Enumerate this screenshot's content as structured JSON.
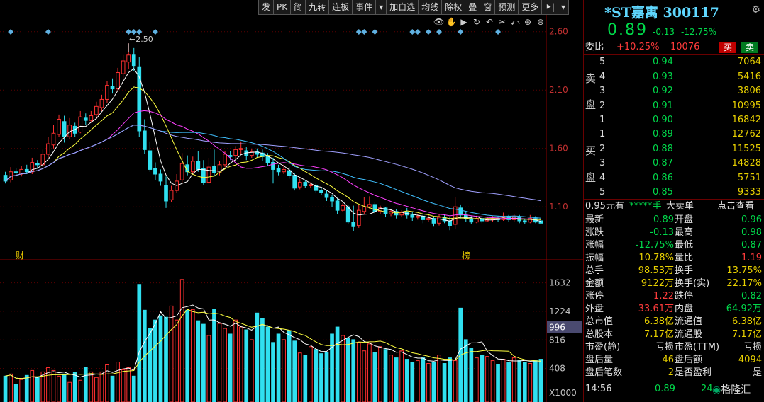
{
  "toolbar": [
    "发",
    "PK",
    "简",
    "九转",
    "连板",
    "事件",
    "▾",
    "加自选",
    "均线",
    "除权",
    "叠",
    "窗",
    "预测",
    "更多",
    "⯈|",
    "▾"
  ],
  "icons": [
    "eye-icon",
    "hand-icon",
    "play-icon",
    "refresh-icon",
    "undo-icon",
    "scissors-icon",
    "return-icon",
    "zoom-in-icon",
    "zoom-out-icon"
  ],
  "icon_glyphs": [
    "👁",
    "✋",
    "▶",
    "↻",
    "↶",
    "✂",
    "⤺",
    "⊕",
    "⊖"
  ],
  "chart_flags": {
    "left": "财",
    "right": "榜"
  },
  "chart_data": [
    {
      "type": "candlestick",
      "price_axis": [
        "2.60",
        "2.10",
        "1.60",
        "1.10"
      ],
      "ylim": [
        0.78,
        2.75
      ],
      "peak_label": "2.50",
      "peak_value": 2.5,
      "candles": [
        [
          1.37,
          1.32,
          1.4,
          1.3
        ],
        [
          1.33,
          1.4,
          1.44,
          1.31
        ],
        [
          1.4,
          1.39,
          1.43,
          1.36
        ],
        [
          1.38,
          1.42,
          1.45,
          1.36
        ],
        [
          1.42,
          1.4,
          1.46,
          1.38
        ],
        [
          1.4,
          1.48,
          1.52,
          1.38
        ],
        [
          1.47,
          1.46,
          1.5,
          1.43
        ],
        [
          1.46,
          1.55,
          1.59,
          1.44
        ],
        [
          1.55,
          1.64,
          1.7,
          1.52
        ],
        [
          1.63,
          1.73,
          1.8,
          1.6
        ],
        [
          1.72,
          1.85,
          1.89,
          1.7
        ],
        [
          1.83,
          1.7,
          1.88,
          1.65
        ],
        [
          1.7,
          1.8,
          1.86,
          1.68
        ],
        [
          1.79,
          1.73,
          1.82,
          1.7
        ],
        [
          1.74,
          1.87,
          1.92,
          1.73
        ],
        [
          1.86,
          1.84,
          1.9,
          1.8
        ],
        [
          1.84,
          1.88,
          1.92,
          1.82
        ],
        [
          1.89,
          1.96,
          2.0,
          1.86
        ],
        [
          1.95,
          2.02,
          2.06,
          1.92
        ],
        [
          2.02,
          2.14,
          2.18,
          1.99
        ],
        [
          2.13,
          2.11,
          2.2,
          2.07
        ],
        [
          2.11,
          2.25,
          2.29,
          2.09
        ],
        [
          2.24,
          2.35,
          2.4,
          2.2
        ],
        [
          2.34,
          2.4,
          2.5,
          2.28
        ],
        [
          2.4,
          2.31,
          2.46,
          2.26
        ],
        [
          2.3,
          1.75,
          2.38,
          1.7
        ],
        [
          1.75,
          1.59,
          1.85,
          1.55
        ],
        [
          1.58,
          1.42,
          1.66,
          1.4
        ],
        [
          1.43,
          1.38,
          1.48,
          1.33
        ],
        [
          1.38,
          1.32,
          1.42,
          1.28
        ],
        [
          1.28,
          1.15,
          1.36,
          1.09
        ],
        [
          1.16,
          1.24,
          1.28,
          1.14
        ],
        [
          1.24,
          1.32,
          1.38,
          1.22
        ],
        [
          1.33,
          1.47,
          1.56,
          1.3
        ],
        [
          1.46,
          1.4,
          1.54,
          1.37
        ],
        [
          1.4,
          1.49,
          1.53,
          1.38
        ],
        [
          1.49,
          1.42,
          1.58,
          1.4
        ],
        [
          1.43,
          1.31,
          1.5,
          1.29
        ],
        [
          1.31,
          1.44,
          1.52,
          1.3
        ],
        [
          1.45,
          1.39,
          1.59,
          1.36
        ],
        [
          1.39,
          1.46,
          1.49,
          1.37
        ],
        [
          1.46,
          1.55,
          1.58,
          1.44
        ],
        [
          1.54,
          1.53,
          1.58,
          1.5
        ],
        [
          1.54,
          1.59,
          1.62,
          1.51
        ],
        [
          1.59,
          1.6,
          1.66,
          1.55
        ],
        [
          1.58,
          1.54,
          1.61,
          1.5
        ],
        [
          1.54,
          1.57,
          1.6,
          1.52
        ],
        [
          1.57,
          1.55,
          1.6,
          1.52
        ],
        [
          1.56,
          1.53,
          1.59,
          1.49
        ],
        [
          1.53,
          1.48,
          1.56,
          1.45
        ],
        [
          1.48,
          1.42,
          1.52,
          1.3
        ],
        [
          1.43,
          1.4,
          1.46,
          1.37
        ],
        [
          1.4,
          1.42,
          1.46,
          1.38
        ],
        [
          1.41,
          1.37,
          1.44,
          1.34
        ],
        [
          1.37,
          1.26,
          1.39,
          1.24
        ],
        [
          1.27,
          1.31,
          1.34,
          1.25
        ],
        [
          1.31,
          1.28,
          1.33,
          1.26
        ],
        [
          1.28,
          1.29,
          1.31,
          1.26
        ],
        [
          1.28,
          1.24,
          1.3,
          1.22
        ],
        [
          1.24,
          1.22,
          1.27,
          1.2
        ],
        [
          1.21,
          1.18,
          1.24,
          1.15
        ],
        [
          1.18,
          1.15,
          1.2,
          1.1
        ],
        [
          1.15,
          1.07,
          1.17,
          1.04
        ],
        [
          1.07,
          1.11,
          1.13,
          1.06
        ],
        [
          1.1,
          0.97,
          1.12,
          0.95
        ],
        [
          0.97,
          0.93,
          1.11,
          0.89
        ],
        [
          0.94,
          1.07,
          1.12,
          0.92
        ],
        [
          1.06,
          1.1,
          1.18,
          1.04
        ],
        [
          1.1,
          1.12,
          1.19,
          1.08
        ],
        [
          1.12,
          1.06,
          1.14,
          1.04
        ],
        [
          1.06,
          1.09,
          1.11,
          1.04
        ],
        [
          1.09,
          1.04,
          1.1,
          1.01
        ],
        [
          1.04,
          1.06,
          1.08,
          1.02
        ],
        [
          1.06,
          1.03,
          1.08,
          1.0
        ],
        [
          1.03,
          1.05,
          1.07,
          1.01
        ],
        [
          1.05,
          1.03,
          1.09,
          1.0
        ],
        [
          1.03,
          1.01,
          1.06,
          0.98
        ],
        [
          1.01,
          1.02,
          1.04,
          0.99
        ],
        [
          1.02,
          0.99,
          1.04,
          0.96
        ],
        [
          0.99,
          1.0,
          1.03,
          0.97
        ],
        [
          1.0,
          0.96,
          1.02,
          0.93
        ],
        [
          0.96,
          1.01,
          1.04,
          0.94
        ],
        [
          1.01,
          0.98,
          1.04,
          0.96
        ],
        [
          0.98,
          0.94,
          1.01,
          0.9
        ],
        [
          0.95,
          1.1,
          1.18,
          0.91
        ],
        [
          1.09,
          1.03,
          1.12,
          1.0
        ],
        [
          1.03,
          1.0,
          1.06,
          0.97
        ],
        [
          1.0,
          0.97,
          1.02,
          0.95
        ],
        [
          0.97,
          1.0,
          1.02,
          0.96
        ],
        [
          1.0,
          0.98,
          1.02,
          0.96
        ],
        [
          0.98,
          0.99,
          1.01,
          0.97
        ],
        [
          0.99,
          1.0,
          1.02,
          0.97
        ],
        [
          1.0,
          0.99,
          1.02,
          0.97
        ],
        [
          0.99,
          1.02,
          1.05,
          0.98
        ],
        [
          1.02,
          0.99,
          1.03,
          0.97
        ],
        [
          0.99,
          1.02,
          1.04,
          0.97
        ],
        [
          1.01,
          0.98,
          1.03,
          0.96
        ],
        [
          0.98,
          0.97,
          1.0,
          0.95
        ],
        [
          0.97,
          1.0,
          1.03,
          0.96
        ],
        [
          1.0,
          0.97,
          1.02,
          0.96
        ],
        [
          0.98,
          0.96,
          1.0,
          0.95
        ]
      ],
      "ma_colors": [
        "#ffffff",
        "#ffff40",
        "#ff40ff",
        "#40c0ff",
        "#a0a0ff",
        "#ffffff"
      ]
    },
    {
      "type": "bar",
      "volume_axis": [
        "1632",
        "1224",
        "996",
        "816",
        "408",
        "X1000"
      ],
      "ylim": [
        0,
        1850
      ],
      "volume": [
        300,
        330,
        180,
        250,
        310,
        380,
        280,
        360,
        420,
        380,
        300,
        330,
        210,
        350,
        240,
        420,
        360,
        280,
        360,
        460,
        300,
        500,
        390,
        420,
        300,
        1610,
        1240,
        980,
        1100,
        1160,
        1140,
        1300,
        1100,
        1680,
        1240,
        1250,
        1090,
        1040,
        880,
        1250,
        1050,
        980,
        900,
        1100,
        1000,
        960,
        820,
        1200,
        1120,
        1000,
        780,
        900,
        820,
        950,
        800,
        630,
        600,
        720,
        680,
        620,
        640,
        900,
        1000,
        880,
        840,
        820,
        780,
        660,
        760,
        640,
        720,
        680,
        600,
        560,
        660,
        540,
        500,
        520,
        560,
        480,
        500,
        600,
        480,
        560,
        520,
        1270,
        820,
        700,
        560,
        600,
        580,
        520,
        460,
        540,
        500,
        560,
        520,
        500,
        480,
        520,
        540
      ]
    }
  ],
  "side": {
    "title": "*ST嘉寓 300117",
    "price": "0.89",
    "change": "-0.13",
    "change_pct": "-12.75%",
    "weibi_label": "委比",
    "weibi_pct": "+10.25%",
    "weibi_num": "10076",
    "buy_btn": "买",
    "sell_btn": "卖",
    "ask_label": [
      "卖",
      "盘"
    ],
    "bid_label": [
      "买",
      "盘"
    ],
    "asks": [
      {
        "lvl": "5",
        "price": "0.94",
        "vol": "7064"
      },
      {
        "lvl": "4",
        "price": "0.93",
        "vol": "5416"
      },
      {
        "lvl": "3",
        "price": "0.92",
        "vol": "3806"
      },
      {
        "lvl": "2",
        "price": "0.91",
        "vol": "10995"
      },
      {
        "lvl": "1",
        "price": "0.90",
        "vol": "16842"
      }
    ],
    "bids": [
      {
        "lvl": "1",
        "price": "0.89",
        "vol": "12762"
      },
      {
        "lvl": "2",
        "price": "0.88",
        "vol": "11525"
      },
      {
        "lvl": "3",
        "price": "0.87",
        "vol": "14828"
      },
      {
        "lvl": "4",
        "price": "0.86",
        "vol": "5751"
      },
      {
        "lvl": "5",
        "price": "0.85",
        "vol": "9333"
      }
    ],
    "bigorder": {
      "a": "0.95元有",
      "b": "*****手",
      "c": "大卖单",
      "d": "点击查看"
    },
    "stats": [
      {
        "l1": "最新",
        "v1": "0.89",
        "c1": "green",
        "l2": "开盘",
        "v2": "0.96",
        "c2": "green"
      },
      {
        "l1": "涨跌",
        "v1": "-0.13",
        "c1": "green",
        "l2": "最高",
        "v2": "0.98",
        "c2": "green"
      },
      {
        "l1": "涨幅",
        "v1": "-12.75%",
        "c1": "green",
        "l2": "最低",
        "v2": "0.87",
        "c2": "green"
      },
      {
        "l1": "振幅",
        "v1": "10.78%",
        "c1": "yellow",
        "l2": "量比",
        "v2": "1.19",
        "c2": "red"
      },
      {
        "l1": "总手",
        "v1": "98.53万",
        "c1": "yellow",
        "l2": "换手",
        "v2": "13.75%",
        "c2": "yellow"
      },
      {
        "l1": "金额",
        "v1": "9122万",
        "c1": "yellow",
        "l2": "换手(实)",
        "v2": "22.17%",
        "c2": "yellow"
      },
      {
        "l1": "涨停",
        "v1": "1.22",
        "c1": "red",
        "l2": "跌停",
        "v2": "0.82",
        "c2": "green"
      },
      {
        "l1": "外盘",
        "v1": "33.61万",
        "c1": "red",
        "l2": "内盘",
        "v2": "64.92万",
        "c2": "green"
      },
      {
        "l1": "总市值",
        "v1": "6.38亿",
        "c1": "yellow",
        "l2": "流通值",
        "v2": "6.38亿",
        "c2": "yellow"
      },
      {
        "l1": "总股本",
        "v1": "7.17亿",
        "c1": "yellow",
        "l2": "流通股",
        "v2": "7.17亿",
        "c2": "yellow"
      },
      {
        "l1": "市盈(静)",
        "v1": "亏损",
        "c1": "white",
        "l2": "市盈(TTM)",
        "v2": "亏损",
        "c2": "white"
      },
      {
        "l1": "盘后量",
        "v1": "46",
        "c1": "yellow",
        "l2": "盘后额",
        "v2": "4094",
        "c2": "yellow"
      },
      {
        "l1": "盘后笔数",
        "v1": "2",
        "c1": "yellow",
        "l2": "是否盈利",
        "v2": "是",
        "c2": "white"
      }
    ],
    "tick": {
      "time": "14:56",
      "price": "0.89",
      "vol": "24"
    },
    "watermark": "格隆汇"
  }
}
